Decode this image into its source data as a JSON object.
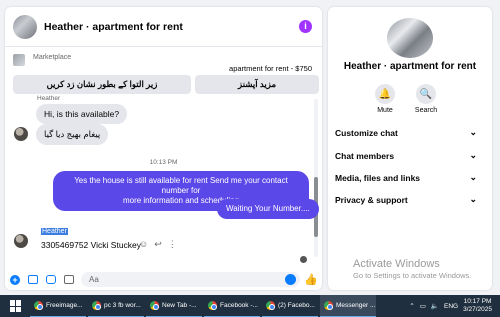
{
  "chat": {
    "title": "Heather · apartment for rent",
    "info_icon": "info-icon",
    "marketplace_label": "Marketplace",
    "listing_price": "apartment for rent - $750",
    "buttons": {
      "left": "زیر التوا کے بطور نشان زد کریں",
      "right": "مزید آپشنز"
    },
    "messages": [
      {
        "sender": "Heather",
        "text": "Hi, is this available?"
      },
      {
        "text": "پیغام بھیج دیا گیا"
      }
    ],
    "timestamp": "10:13 PM",
    "outgoing": [
      {
        "line1": "Yes the house is still available for rent Send me your contact number for",
        "line2": "more  information and  scheduling"
      },
      {
        "text": "Waiting Your Number...."
      }
    ],
    "last_sender": "Heather",
    "last_message": "3305469752 Vicki Stuckey",
    "composer_placeholder": "Aa"
  },
  "side": {
    "title": "Heather · apartment for rent",
    "mute_label": "Mute",
    "search_label": "Search",
    "items": [
      "Customize chat",
      "Chat members",
      "Media, files and links",
      "Privacy & support"
    ]
  },
  "watermark": {
    "line1": "Activate Windows",
    "line2": "Go to Settings to activate Windows."
  },
  "taskbar": {
    "items": [
      {
        "label": "Freeimage..."
      },
      {
        "label": "pc 3 fb wor..."
      },
      {
        "label": "New Tab -..."
      },
      {
        "label": "Facebook -..."
      },
      {
        "label": "(2) Facebo..."
      },
      {
        "label": "Messenger ..."
      }
    ],
    "language": "ENG",
    "time": "10:17 PM",
    "date": "3/27/2025"
  },
  "colors": {
    "accent": "#0a7cff",
    "outgoing_bubble": "#5b48e8",
    "info": "#a033ff"
  }
}
